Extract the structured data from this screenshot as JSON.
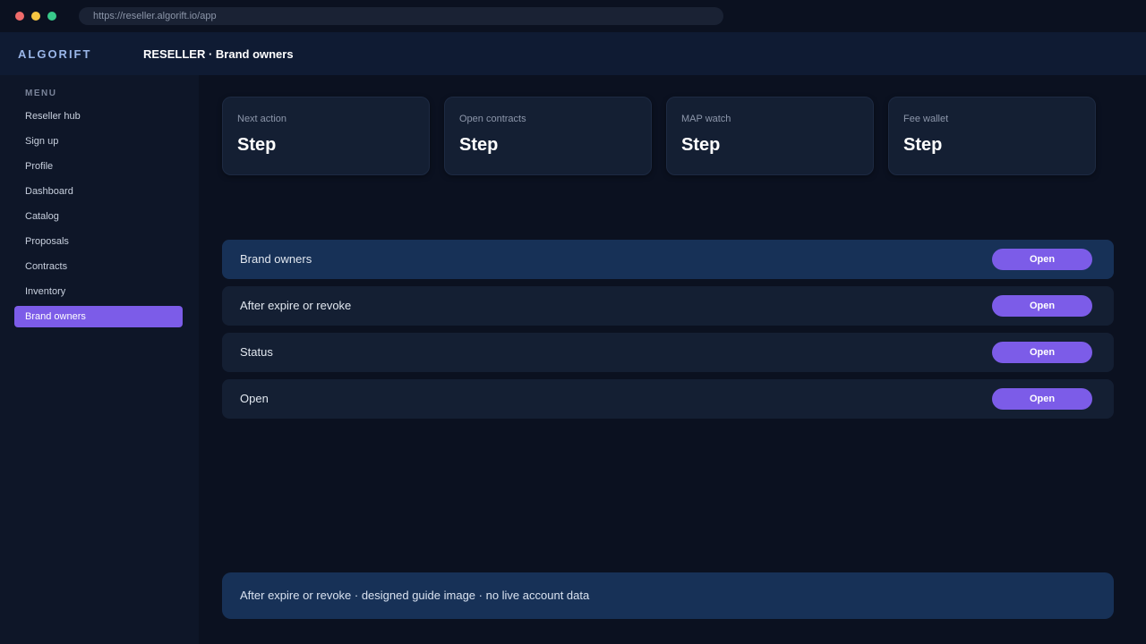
{
  "browser": {
    "url": "https://reseller.algorift.io/app"
  },
  "header": {
    "brand": "ALGORIFT",
    "title": "RESELLER · Brand owners"
  },
  "sidebar": {
    "menu_label": "MENU",
    "items": [
      {
        "label": "Reseller hub",
        "active": false
      },
      {
        "label": "Sign up",
        "active": false
      },
      {
        "label": "Profile",
        "active": false
      },
      {
        "label": "Dashboard",
        "active": false
      },
      {
        "label": "Catalog",
        "active": false
      },
      {
        "label": "Proposals",
        "active": false
      },
      {
        "label": "Contracts",
        "active": false
      },
      {
        "label": "Inventory",
        "active": false
      },
      {
        "label": "Brand owners",
        "active": true
      }
    ]
  },
  "cards": [
    {
      "label": "Next action",
      "value": "Step"
    },
    {
      "label": "Open contracts",
      "value": "Step"
    },
    {
      "label": "MAP watch",
      "value": "Step"
    },
    {
      "label": "Fee wallet",
      "value": "Step"
    }
  ],
  "rows": [
    {
      "label": "Brand owners",
      "button": "Open",
      "highlighted": true
    },
    {
      "label": "After expire or revoke",
      "button": "Open",
      "highlighted": false
    },
    {
      "label": "Status",
      "button": "Open",
      "highlighted": false
    },
    {
      "label": "Open",
      "button": "Open",
      "highlighted": false
    }
  ],
  "footer": {
    "note": "After expire or revoke · designed guide image · no live account data"
  },
  "colors": {
    "accent": "#7c5ce8",
    "background": "#0b1120",
    "highlight": "#173157"
  }
}
